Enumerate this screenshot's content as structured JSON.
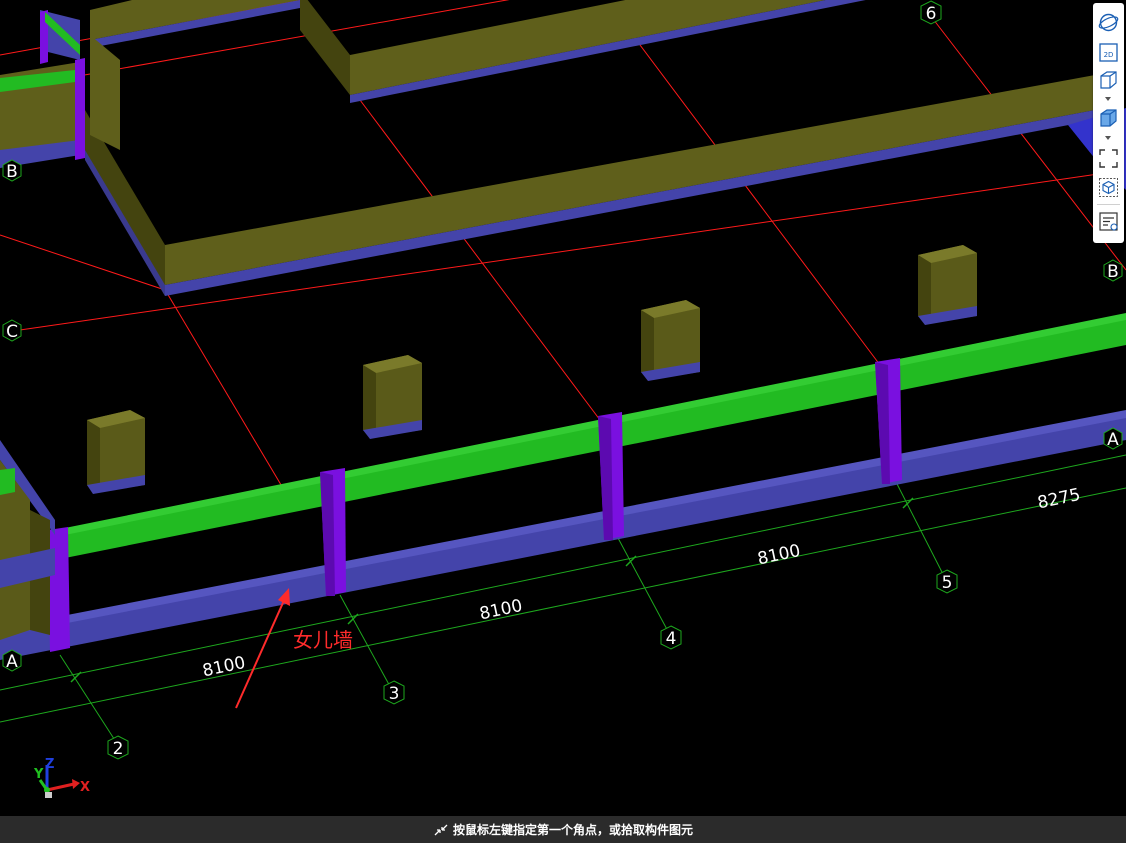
{
  "viewport": {
    "axis_labels": {
      "row_c": "C",
      "row_b_left": "B",
      "row_b_right": "B",
      "row_a_left": "A",
      "row_a_right": "A",
      "col_2": "2",
      "col_3": "3",
      "col_4": "4",
      "col_5": "5",
      "col_6": "6"
    },
    "dimensions": [
      "8100",
      "8100",
      "8100",
      "8275"
    ],
    "annotation": "女儿墙",
    "coordinate_axes": {
      "x": "X",
      "y": "Y",
      "z": "Z"
    }
  },
  "toolbar": {
    "items": [
      {
        "name": "orbit",
        "icon": "orbit-sphere-icon"
      },
      {
        "name": "2d-view",
        "icon": "2d-view-icon",
        "label": "2D"
      },
      {
        "name": "view-cube",
        "icon": "view-cube-icon"
      },
      {
        "name": "shaded-cube",
        "icon": "shaded-cube-icon"
      },
      {
        "name": "zoom-extents",
        "icon": "zoom-extents-icon"
      },
      {
        "name": "select-box",
        "icon": "selection-cube-icon"
      },
      {
        "name": "properties",
        "icon": "properties-list-icon"
      }
    ]
  },
  "statusbar": {
    "message": "按鼠标左键指定第一个角点，或拾取构件图元"
  },
  "colors": {
    "background": "#000000",
    "grid_red": "#ff1a1a",
    "grid_green": "#1ea81e",
    "wall_olive": "#5a5a19",
    "wall_olive_light": "#6d6d20",
    "wall_blue": "#4444aa",
    "beam_green": "#22bb22",
    "column_purple": "#7a10e0",
    "annotation_red": "#ff2b2b"
  }
}
